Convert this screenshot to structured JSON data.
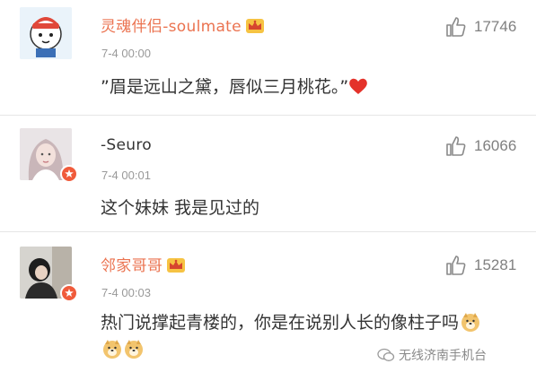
{
  "comments": [
    {
      "username": "灵魂伴侣-soulmate",
      "timestamp": "7-4 00:00",
      "content": "”眉是远山之黛，唇似三月桃花。”",
      "likes": "17746",
      "verified": false,
      "badge": "crown-icon"
    },
    {
      "username": "-Seuro",
      "timestamp": "7-4 00:01",
      "content": "这个妹妹 我是见过的",
      "likes": "16066",
      "verified": true,
      "badge": "v-verified-icon"
    },
    {
      "username": "邻家哥哥",
      "timestamp": "7-4 00:03",
      "content": "热门说撑起青楼的，你是在说别人长的像柱子吗",
      "likes": "15281",
      "verified": true,
      "badge": "crown-icon"
    }
  ],
  "watermark": {
    "text": "无线济南手机台"
  },
  "colors": {
    "name_highlight": "#eb7350",
    "verified_badge": "#f05b3b",
    "muted": "#999999"
  }
}
